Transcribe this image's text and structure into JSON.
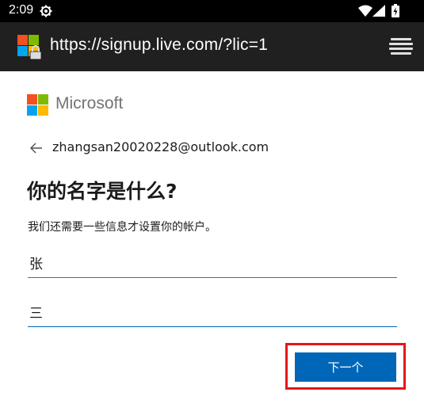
{
  "status_bar": {
    "time": "2:09",
    "icons": [
      "settings-gear-icon",
      "wifi-icon",
      "cell-signal-icon",
      "battery-icon"
    ]
  },
  "browser": {
    "url": "https://signup.live.com/?lic=1",
    "site_icon": "microsoft-lock-icon",
    "menu_icon": "tabs-menu-icon"
  },
  "page": {
    "brand": "Microsoft",
    "brand_colors": [
      "#f25022",
      "#7fba00",
      "#00a4ef",
      "#ffb900"
    ],
    "back_email": "zhangsan20020228@outlook.com",
    "heading": "你的名字是什么?",
    "description": "我们还需要一些信息才设置你的帐户。",
    "last_name_value": "张",
    "first_name_value": "三",
    "next_label": "下一个",
    "accent_color": "#0067b8",
    "highlight_color": "#e3161b"
  }
}
